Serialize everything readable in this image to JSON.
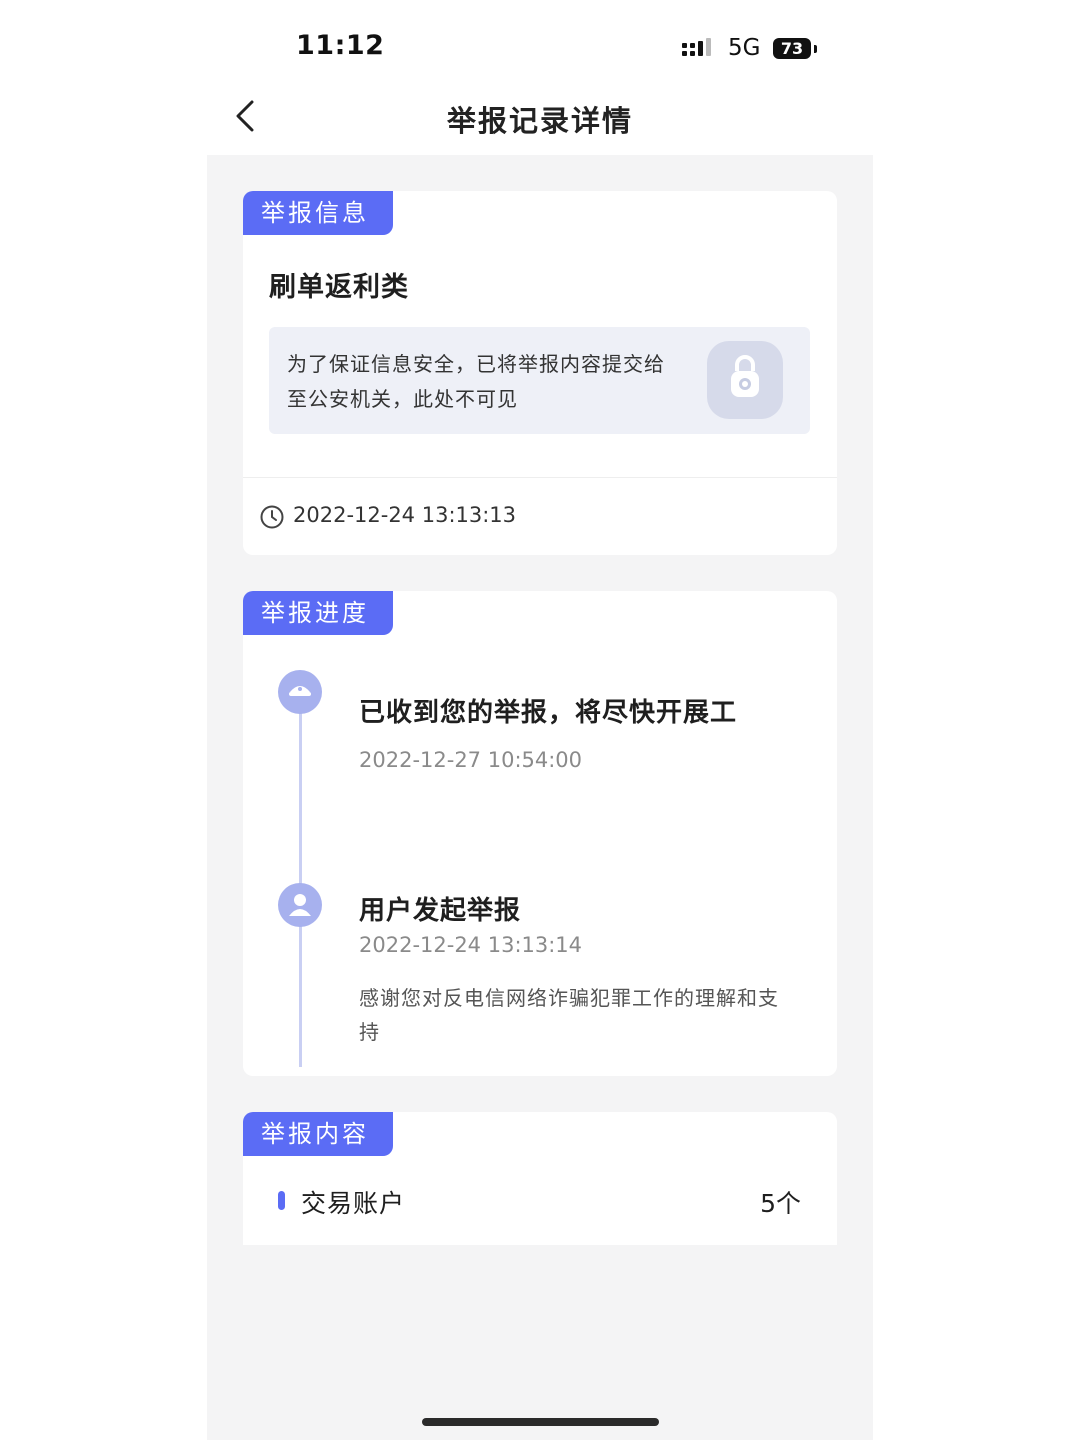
{
  "status_bar": {
    "time": "11:12",
    "network": "5G",
    "battery": "73"
  },
  "nav": {
    "title": "举报记录详情",
    "back_icon": "chevron-left-icon"
  },
  "report_info": {
    "tag": "举报信息",
    "category": "刷单返利类",
    "notice": "为了保证信息安全，已将举报内容提交给至公安机关，此处不可见",
    "lock_icon": "lock-icon",
    "time_icon": "clock-icon",
    "submitted_at": "2022-12-24 13:13:13"
  },
  "progress": {
    "tag": "举报进度",
    "steps": [
      {
        "icon": "police-icon",
        "title": "已收到您的举报，将尽快开展工",
        "time": "2022-12-27 10:54:00"
      },
      {
        "icon": "user-icon",
        "title": "用户发起举报",
        "time": "2022-12-24 13:13:14",
        "note": "感谢您对反电信网络诈骗犯罪工作的理解和支持"
      }
    ]
  },
  "content": {
    "tag": "举报内容",
    "items": [
      {
        "label": "交易账户",
        "count": "5个"
      }
    ]
  },
  "colors": {
    "accent": "#5b6cf5",
    "page_bg": "#f4f4f5",
    "node": "#a7b1ee"
  }
}
